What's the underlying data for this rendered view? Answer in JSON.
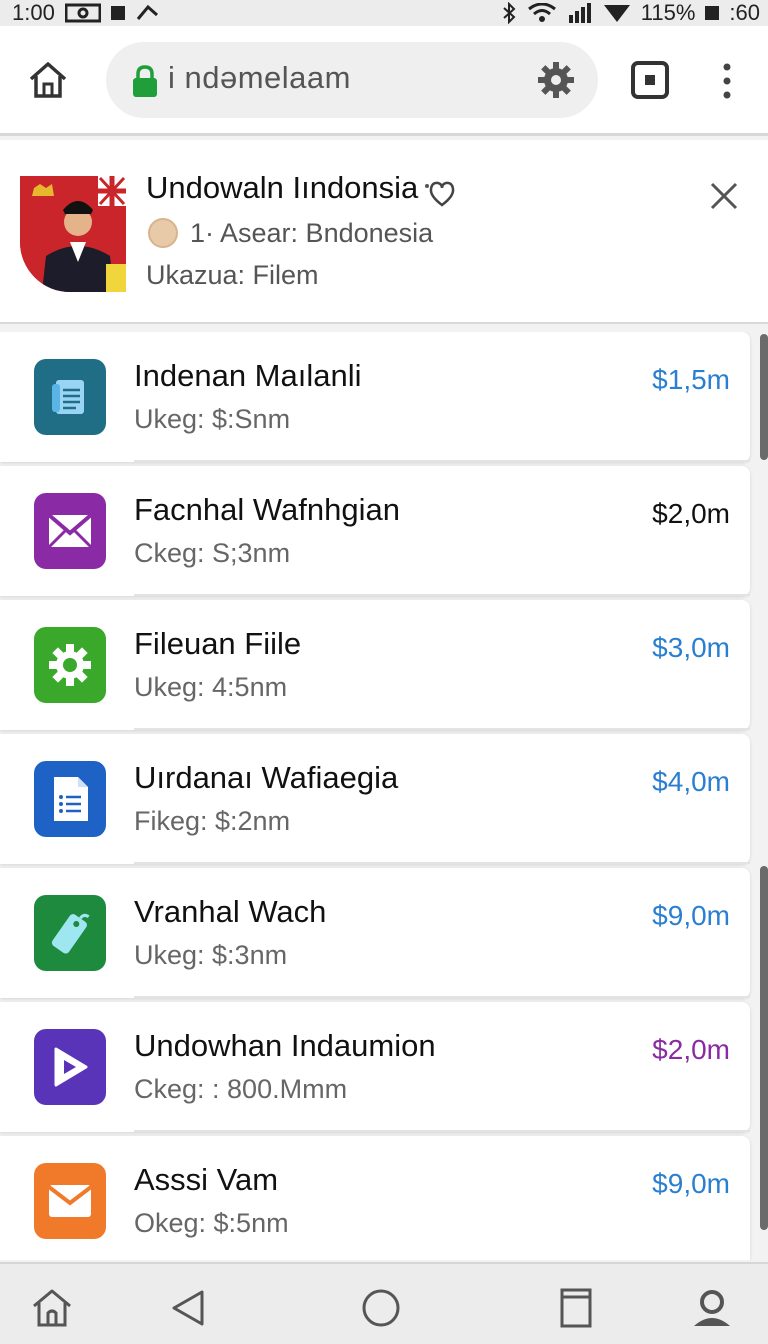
{
  "status_bar": {
    "time": "1:00",
    "battery": "115%",
    "clock_right": ":60",
    "icons": [
      "camera-icon",
      "notification-icon",
      "link-icon",
      "bluetooth-icon",
      "wifi-icon",
      "signal-icon",
      "battery-icon"
    ]
  },
  "browser": {
    "url": "i ndəmelaam",
    "icons": [
      "home-icon",
      "lock-icon",
      "gear-icon",
      "tabs-icon",
      "more-icon"
    ],
    "accent": "#1f9e3a"
  },
  "profile": {
    "name": "Undowaln Iındonsia",
    "subtitle": "1· Asear: Bndonesia",
    "category": "Ukazua: Filem",
    "icons": [
      "flag-avatar-icon",
      "heart-icon",
      "close-icon"
    ]
  },
  "items": [
    {
      "title": "Indenan Maılanli",
      "subtitle": "Ukeg:  $:Snm",
      "price": "$1,5m",
      "price_color": "#2b7fd0",
      "icon": "document-icon",
      "icon_bg": "#1f6e86"
    },
    {
      "title": "Facnhal Wafnhgian",
      "subtitle": "Ckeg:  S;3nm",
      "price": "$2,0m",
      "price_color": "#111111",
      "icon": "mail-icon",
      "icon_bg": "#8a2aa5"
    },
    {
      "title": "Fileuan Fiile",
      "subtitle": "Ukeg:  4:5nm",
      "price": "$3,0m",
      "price_color": "#2b7fd0",
      "icon": "gear-icon",
      "icon_bg": "#3aa82a"
    },
    {
      "title": "Uırdanaı Wafiaegia",
      "subtitle": "Fikeg:  $:2nm",
      "price": "$4,0m",
      "price_color": "#2b7fd0",
      "icon": "list-document-icon",
      "icon_bg": "#1f62c6"
    },
    {
      "title": "Vranhal Wach",
      "subtitle": "Ukeg:  $:3nm",
      "price": "$9,0m",
      "price_color": "#2b7fd0",
      "icon": "tag-icon",
      "icon_bg": "#1e8a3e"
    },
    {
      "title": "Undowhan Indaumion",
      "subtitle": "Ckeg: : 800.Mmm",
      "price": "$2,0m",
      "price_color": "#8a2aa5",
      "icon": "play-icon",
      "icon_bg": "#5a34b8"
    },
    {
      "title": "Asssi Vam",
      "subtitle": "Okeg:  $:5nm",
      "price": "$9,0m",
      "price_color": "#2b7fd0",
      "icon": "envelope-icon",
      "icon_bg": "#f07a2a"
    }
  ],
  "nav_bar": {
    "icons": [
      "home-icon",
      "back-icon",
      "circle-home-icon",
      "recents-icon",
      "account-icon"
    ]
  }
}
